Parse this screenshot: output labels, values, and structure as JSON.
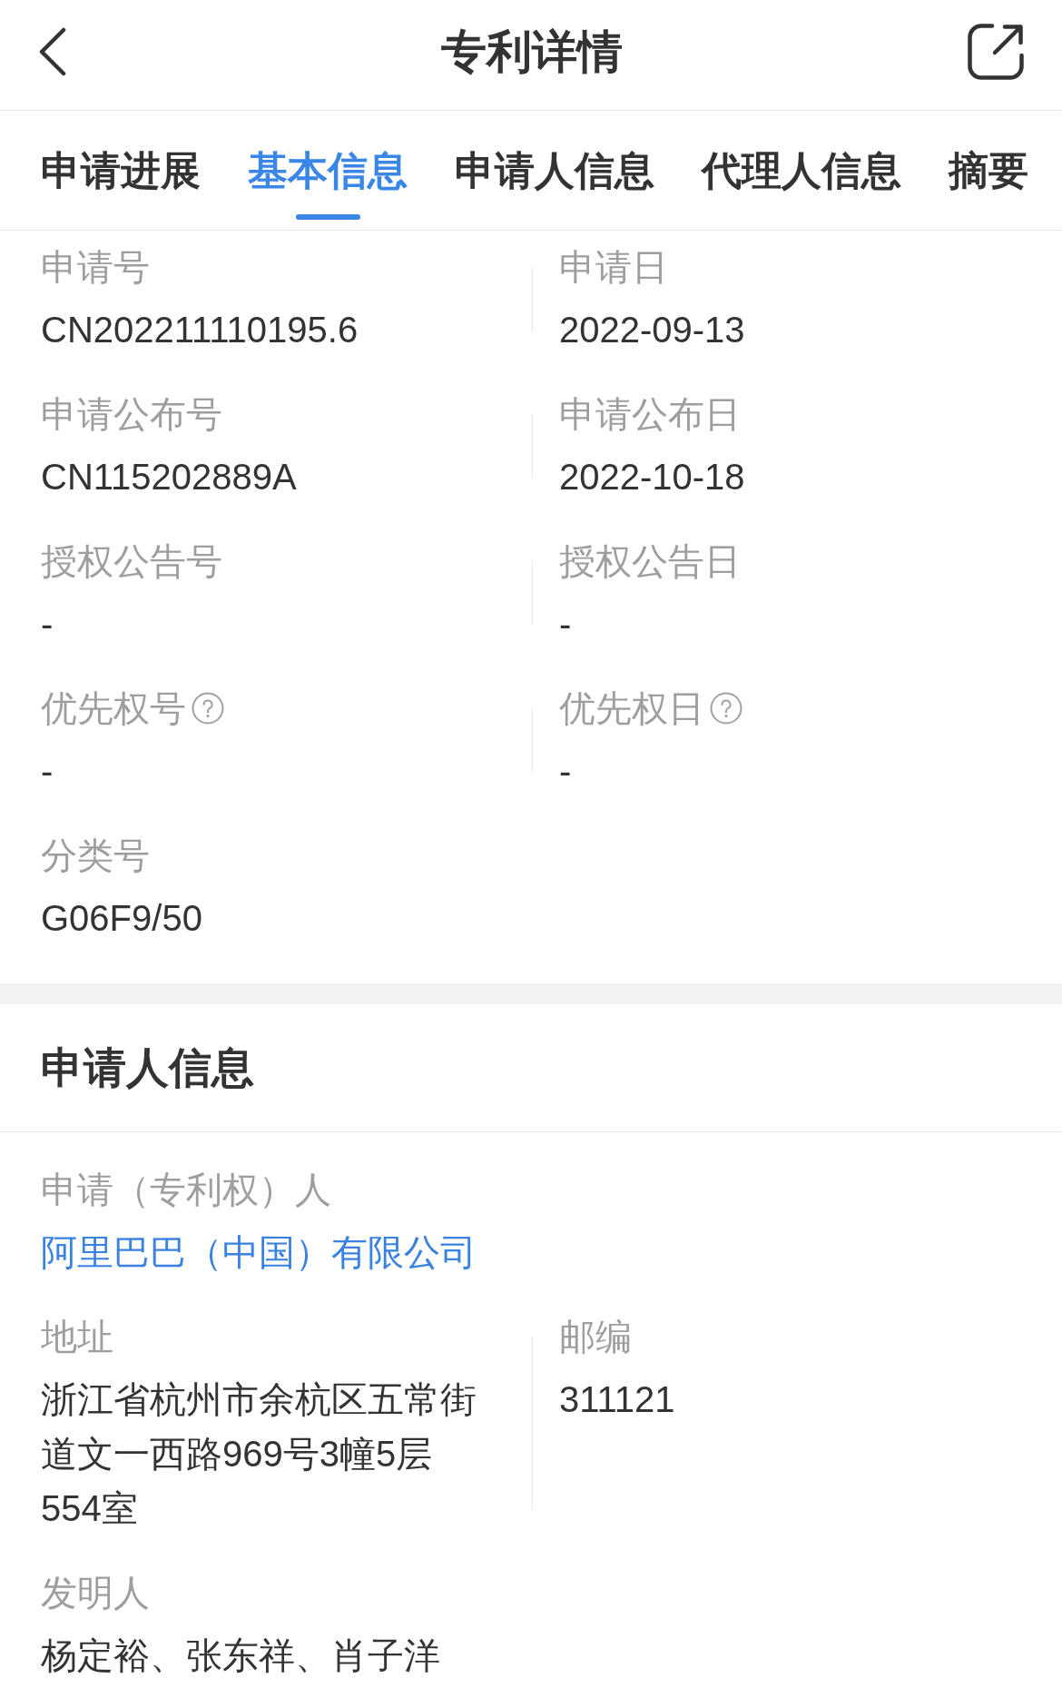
{
  "header": {
    "title": "专利详情"
  },
  "tabs": [
    {
      "label": "申请进展",
      "selected": false
    },
    {
      "label": "基本信息",
      "selected": true
    },
    {
      "label": "申请人信息",
      "selected": false
    },
    {
      "label": "代理人信息",
      "selected": false
    },
    {
      "label": "摘要",
      "selected": false
    }
  ],
  "basic_info": {
    "rows": [
      [
        {
          "label": "申请号",
          "value": "CN202211110195.6",
          "help": false
        },
        {
          "label": "申请日",
          "value": "2022-09-13",
          "help": false
        }
      ],
      [
        {
          "label": "申请公布号",
          "value": "CN115202889A",
          "help": false
        },
        {
          "label": "申请公布日",
          "value": "2022-10-18",
          "help": false
        }
      ],
      [
        {
          "label": "授权公告号",
          "value": "-",
          "help": false
        },
        {
          "label": "授权公告日",
          "value": "-",
          "help": false
        }
      ],
      [
        {
          "label": "优先权号",
          "value": "-",
          "help": true
        },
        {
          "label": "优先权日",
          "value": "-",
          "help": true
        }
      ],
      [
        {
          "label": "分类号",
          "value": "G06F9/50",
          "help": false
        }
      ]
    ]
  },
  "applicant_section": {
    "title": "申请人信息",
    "rows": [
      [
        {
          "label": "申请（专利权）人",
          "value": "阿里巴巴（中国）有限公司",
          "kind": "link"
        }
      ],
      [
        {
          "label": "地址",
          "value": "浙江省杭州市余杭区五常街道文一西路969号3幢5层554室",
          "kind": "text"
        },
        {
          "label": "邮编",
          "value": "311121",
          "kind": "text"
        }
      ],
      [
        {
          "label": "发明人",
          "value": "杨定裕、张东祥、肖子洋",
          "kind": "text"
        }
      ]
    ]
  }
}
